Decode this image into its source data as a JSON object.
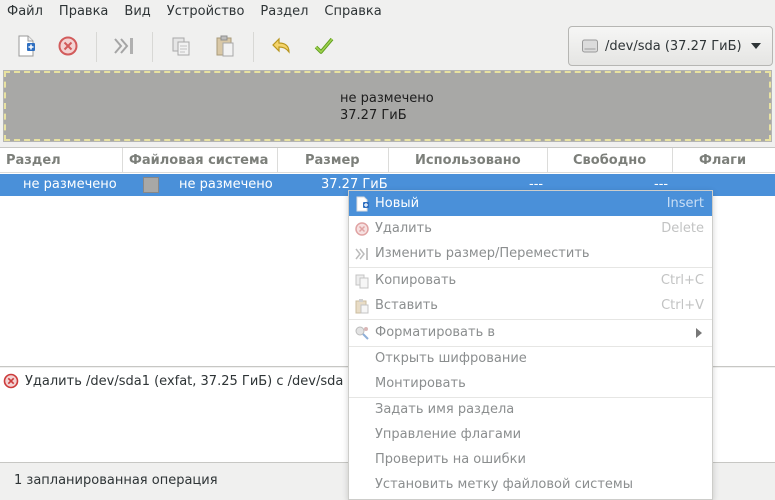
{
  "menubar": {
    "items": [
      "Файл",
      "Правка",
      "Вид",
      "Устройство",
      "Раздел",
      "Справка"
    ]
  },
  "toolbar": {
    "buttons": [
      "new-partition",
      "delete-partition",
      "resize-move",
      "copy",
      "paste",
      "undo",
      "apply"
    ]
  },
  "device": {
    "label": "/dev/sda (37.27 ГиБ)"
  },
  "graph": {
    "line1": "не размечено",
    "line2": "37.27 ГиБ",
    "fill_color": "#a8a8a6"
  },
  "table": {
    "headers": [
      "Раздел",
      "Файловая система",
      "Размер",
      "Использовано",
      "Свободно",
      "Флаги"
    ],
    "rows": [
      {
        "partition": "не размечено",
        "filesystem": "не размечено",
        "size": "37.27 ГиБ",
        "used": "---",
        "free": "---",
        "flags": ""
      }
    ]
  },
  "operations": {
    "items": [
      "Удалить /dev/sda1 (exfat, 37.25 ГиБ) с /dev/sda"
    ]
  },
  "status": {
    "text": "1 запланированная операция"
  },
  "context_menu": {
    "items": [
      {
        "label": "Новый",
        "accel": "Insert"
      },
      {
        "label": "Удалить",
        "accel": "Delete"
      },
      {
        "label": "Изменить размер/Переместить",
        "accel": ""
      },
      {
        "label": "Копировать",
        "accel": "Ctrl+C"
      },
      {
        "label": "Вставить",
        "accel": "Ctrl+V"
      },
      {
        "label": "Форматировать в",
        "accel": ""
      },
      {
        "label": "Открыть шифрование",
        "accel": ""
      },
      {
        "label": "Монтировать",
        "accel": ""
      },
      {
        "label": "Задать имя раздела",
        "accel": ""
      },
      {
        "label": "Управление флагами",
        "accel": ""
      },
      {
        "label": "Проверить на ошибки",
        "accel": ""
      },
      {
        "label": "Установить метку файловой системы",
        "accel": ""
      }
    ]
  },
  "colors": {
    "selection": "#4a90d9",
    "window_bg": "#f0f0ef",
    "disabled_text": "#8b8e8f"
  }
}
